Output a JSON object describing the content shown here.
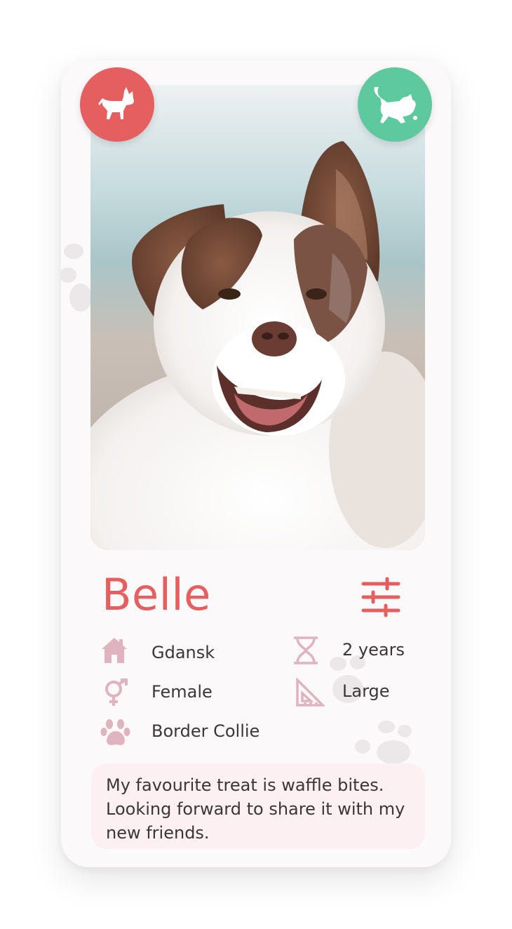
{
  "colors": {
    "accent_red": "#e55f60",
    "accent_green": "#5ec89f",
    "icon_pink": "#dfb3bf",
    "bio_bg": "#fcf0f2",
    "text_dark": "#3b3638"
  },
  "actions": {
    "left": {
      "icon": "dog-icon"
    },
    "right": {
      "icon": "playful-dog-icon"
    }
  },
  "profile": {
    "name": "Belle",
    "filter_icon": "sliders-icon",
    "city": "Gdansk",
    "gender": "Female",
    "breed": "Border Collie",
    "age": "2 years",
    "size": "Large",
    "bio": "My favourite treat is waffle bites. Looking forward to share it with my new friends."
  }
}
